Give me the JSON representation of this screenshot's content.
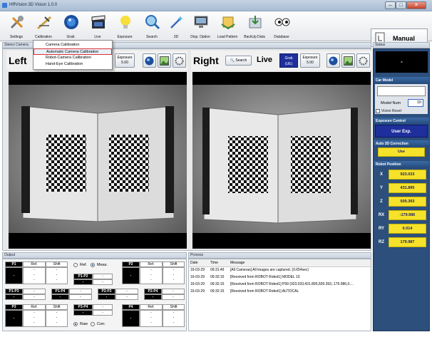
{
  "window": {
    "title": "HRVision 3D Vision 1.0.0",
    "min": "–",
    "max": "□",
    "close": "✕"
  },
  "toolbar": {
    "items": [
      {
        "label": "Settings",
        "icon": "wrench-screwdriver-icon"
      },
      {
        "label": "Calibration",
        "icon": "calibration-icon"
      },
      {
        "label": "Grab",
        "icon": "grab-sphere-icon"
      },
      {
        "label": "Live",
        "icon": "clapperboard-icon"
      },
      {
        "label": "Exposure",
        "icon": "lightbulb-icon"
      },
      {
        "label": "Search",
        "icon": "magnifier-icon"
      },
      {
        "label": "3D",
        "icon": "magic-wand-icon"
      },
      {
        "label": "Disp. Option",
        "icon": "monitor-icon"
      },
      {
        "label": "Load Pattern",
        "icon": "load-pattern-icon"
      },
      {
        "label": "BackUp Data",
        "icon": "backup-icon"
      },
      {
        "label": "Database",
        "icon": "database-eyes-icon"
      }
    ],
    "mode_label": "Manual"
  },
  "menu": {
    "items": [
      "Camera Calibration",
      "Automatic Camera Calibration",
      "Robot-Camera Calibration",
      "Hand-Eye Calibration"
    ],
    "selected": 1
  },
  "stereo": {
    "title": "Stereo Camera",
    "left": {
      "label": "Left",
      "exposure_label": "Exposure",
      "exposure_value": "5.00"
    },
    "right": {
      "label": "Right",
      "search": "Search",
      "live": "Live",
      "grab": "Grab",
      "grab_sub": "(UE)",
      "exposure_label": "Exposure",
      "exposure_value": "5.00"
    }
  },
  "status": {
    "title": "Status",
    "display": "-",
    "car_model": "Car Model",
    "model_num_label": "Model Num",
    "model_num": "10",
    "vision_reset": "Vision Reset",
    "exposure_control": "Exposure Control",
    "user_exp": "User Exp.",
    "auto3d": "Auto 3D Correction",
    "use": "Use",
    "robot_position": "Robot Position",
    "positions": [
      {
        "axis": "X",
        "value": "923.033"
      },
      {
        "axis": "Y",
        "value": "431.895"
      },
      {
        "axis": "Z",
        "value": "509.393"
      },
      {
        "axis": "RX",
        "value": "-179.986"
      },
      {
        "axis": "RY",
        "value": "0.014"
      },
      {
        "axis": "RZ",
        "value": "179.987"
      }
    ]
  },
  "output": {
    "title": "Output",
    "ref": "Ref.",
    "shift": "Shift",
    "mode_ref": "Ref.",
    "mode_meas": "Meas.",
    "raw": "Raw",
    "corr": "Corr.",
    "p1": "P1",
    "p2": "P2",
    "p3": "P3",
    "p4": "P4",
    "p1p2": "P1-P2",
    "p1p3": "P1-P3",
    "p1p4": "P1-P4",
    "p2p3": "P2-P3",
    "p2p4": "P2-P4",
    "p3p4": "P3-P4",
    "dash": "-"
  },
  "process": {
    "title": "Process",
    "headers": [
      "Date",
      "Time",
      "Message"
    ],
    "rows": [
      [
        "16-03-29",
        "09:31:49",
        "[All Cameras] All images are captured. (0.654sec)"
      ],
      [
        "16-03-29",
        "09:32:15",
        "[Received from ROBOT Robot1] MODEL 10"
      ],
      [
        "16-03-29",
        "09:32:15",
        "[Received from ROBOT Robot1] P99 (923.033,431.895,509.393,-179.986,0...."
      ],
      [
        "16-03-29",
        "09:32:15",
        "[Received from ROBOT Robot1] AUTOCAL"
      ]
    ]
  },
  "colors": {
    "accent": "#2c4f7c",
    "highlight": "#f7e22b",
    "menu_select": "#d83030"
  }
}
